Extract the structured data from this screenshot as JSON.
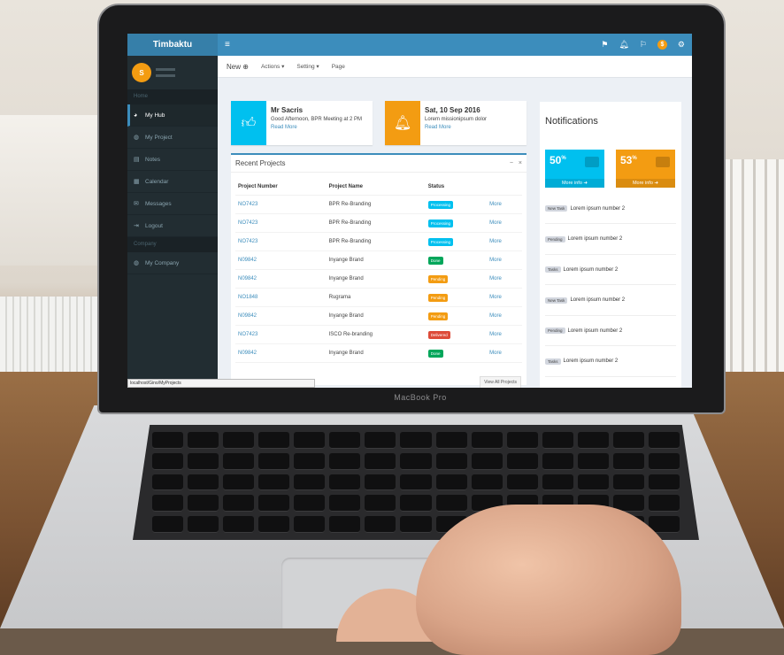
{
  "app": {
    "title": "Timbaktu",
    "toggle_icon": "≡",
    "top_icons": [
      "flag-icon",
      "bell-icon",
      "flag-icon",
      "coin-icon",
      "gear-icon"
    ],
    "coin_label": "$"
  },
  "sidebar": {
    "avatar_letter": "S",
    "section_main": "Home",
    "items": [
      {
        "label": "My Hub",
        "icon": "dashboard-icon",
        "active": true
      },
      {
        "label": "My Project",
        "icon": "globe-icon"
      },
      {
        "label": "Notes",
        "icon": "notes-icon"
      },
      {
        "label": "Calendar",
        "icon": "calendar-icon"
      },
      {
        "label": "Messages",
        "icon": "messages-icon"
      },
      {
        "label": "Logout",
        "icon": "logout-icon"
      }
    ],
    "section_company": "Company",
    "company_item": {
      "label": "My Company",
      "icon": "globe-icon"
    }
  },
  "menubar": {
    "new": "New",
    "actions": "Actions",
    "setting": "Setting",
    "page": "Page"
  },
  "cards": [
    {
      "title": "Mr Sacris",
      "subtitle": "Good Afternoon, BPR Meeting at 2 PM",
      "link": "Read More",
      "color": "#00c0ef",
      "icon": "thumbs-up-icon"
    },
    {
      "title": "Sat, 10 Sep 2016",
      "subtitle": "Lorem missionipsum dolor",
      "link": "Read More",
      "color": "#f39c12",
      "icon": "bell-icon"
    }
  ],
  "projects": {
    "title": "Recent Projects",
    "columns": [
      "Project Number",
      "Project Name",
      "Status"
    ],
    "more_label": "More",
    "view_all": "View All Projects",
    "rows": [
      {
        "number": "NO7423",
        "name": "BPR Re-Branding",
        "status": "Processing",
        "color": "#00c0ef"
      },
      {
        "number": "NO7423",
        "name": "BPR Re-Branding",
        "status": "Processing",
        "color": "#00c0ef"
      },
      {
        "number": "NO7423",
        "name": "BPR Re-Branding",
        "status": "Processing",
        "color": "#00c0ef"
      },
      {
        "number": "N09842",
        "name": "Inyange Brand",
        "status": "Done",
        "color": "#00a65a"
      },
      {
        "number": "N09842",
        "name": "Inyange Brand",
        "status": "Pending",
        "color": "#f39c12"
      },
      {
        "number": "NO1848",
        "name": "Rugrama",
        "status": "Pending",
        "color": "#f39c12"
      },
      {
        "number": "N09842",
        "name": "Inyange Brand",
        "status": "Pending",
        "color": "#f39c12"
      },
      {
        "number": "NO7423",
        "name": "ISCO Re-branding",
        "status": "Delivered",
        "color": "#dd4b39"
      },
      {
        "number": "N09842",
        "name": "Inyange Brand",
        "status": "Done",
        "color": "#00a65a"
      }
    ]
  },
  "status_url": "localhost/Gino/MyProjects",
  "notifications": {
    "title": "Notifications",
    "stats": [
      {
        "value": "50",
        "unit": "%",
        "link": "More info",
        "color": "#00c0ef"
      },
      {
        "value": "53",
        "unit": "%",
        "link": "More info",
        "color": "#f39c12"
      }
    ],
    "items": [
      {
        "tag": "New Task",
        "text": "Lorem ipsum number 2"
      },
      {
        "tag": "Pending",
        "text": "Lorem ipsum number 2"
      },
      {
        "tag": "Tasks",
        "text": "Lorem ipsum number 2"
      },
      {
        "tag": "New Task",
        "text": "Lorem ipsum number 2"
      },
      {
        "tag": "Pending",
        "text": "Lorem ipsum number 2"
      },
      {
        "tag": "Tasks",
        "text": "Lorem ipsum number 2"
      }
    ]
  },
  "laptop_brand": "MacBook Pro"
}
